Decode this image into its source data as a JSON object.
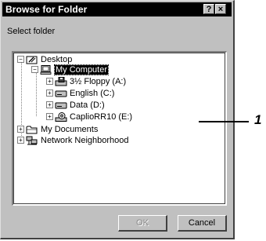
{
  "window": {
    "title": "Browse for Folder",
    "help_label": "?",
    "close_label": "×"
  },
  "prompt": "Select folder",
  "tree": {
    "desktop": "Desktop",
    "my_computer": "My Computer",
    "drives": [
      "3½ Floppy (A:)",
      "English (C:)",
      "Data (D:)",
      "CaplioRR10 (E:)"
    ],
    "my_documents": "My Documents",
    "network": "Network Neighborhood"
  },
  "buttons": {
    "ok": "OK",
    "cancel": "Cancel"
  },
  "callout": "1"
}
